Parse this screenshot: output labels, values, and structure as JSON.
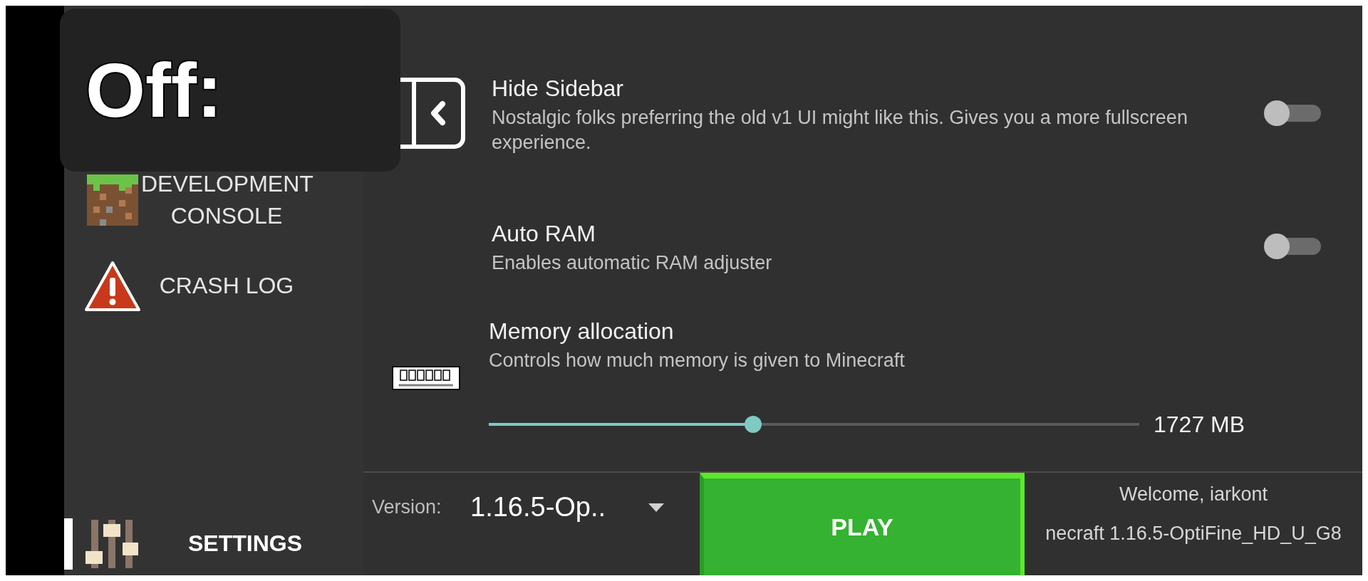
{
  "overlay": {
    "label": "Off:"
  },
  "sidebar": {
    "items": [
      {
        "label": "DEVELOPMENT CONSOLE",
        "kind": "grass",
        "selected": false
      },
      {
        "label": "CRASH LOG",
        "kind": "warning",
        "selected": false
      },
      {
        "label": "SETTINGS",
        "kind": "sliders",
        "selected": true
      }
    ]
  },
  "settings": [
    {
      "kind": "toggle",
      "title": "Hide Sidebar",
      "description": "Nostalgic folks preferring the old v1 UI might like this. Gives you a more fullscreen experience.",
      "on": false
    },
    {
      "kind": "toggle",
      "title": "Auto RAM",
      "description": "Enables automatic RAM adjuster",
      "on": false
    },
    {
      "kind": "slider",
      "title": "Memory allocation",
      "description": "Controls how much memory is given to Minecraft",
      "level": 0.406,
      "reading": "1727 MB"
    }
  ],
  "bottom_bar": {
    "version_label": "Version:",
    "version_value": "1.16.5-Op..",
    "play": "PLAY",
    "welcome": "Welcome, iarkont",
    "profile": "necraft 1.16.5-OptiFine_HD_U_G8"
  }
}
